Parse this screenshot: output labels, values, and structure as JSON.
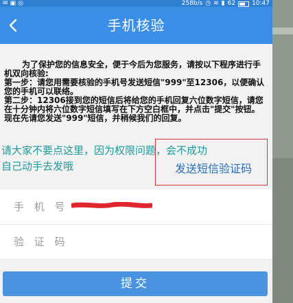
{
  "status_bar": {
    "left_icons": [
      "mail-icon",
      "image-icon",
      "circle-icon"
    ],
    "network_speed": "258b/s",
    "battery_level": "62",
    "time": "10:47"
  },
  "nav": {
    "title": "手机核验"
  },
  "instructions": {
    "intro": "为了保护您的信息安全，便于今后为您服务，请按以下程序进行手机双向核验:",
    "step1": "第一步：请您用需要核验的手机号发送短信\"999\"至12306，以便确认您的手机可以联络。",
    "step2": "第二步：12306接到您的短信后将给您的手机回复六位数字短信，请您在十分钟内将六位数字短信填写在下方空白框中，并点击\"提交\"按钮。 现在先请您发送\"999\"短信，并稍候我们的回复。"
  },
  "annotation": {
    "line1": "请大家不要点这里，因为权限问题，会不成功",
    "line2": "自己动手去发哦"
  },
  "send_sms_label": "发送短信验证码",
  "form": {
    "phone_label": "手 机 号",
    "phone_value": "",
    "code_label": "验 证 码",
    "code_placeholder": ""
  },
  "submit_label": "提交",
  "colors": {
    "nav_blue": "#3a8ee6",
    "button_blue": "#4a93e0",
    "annotation_teal": "#1f9a9a",
    "highlight_red": "#d9343e",
    "link_blue": "#2a6fb5"
  }
}
